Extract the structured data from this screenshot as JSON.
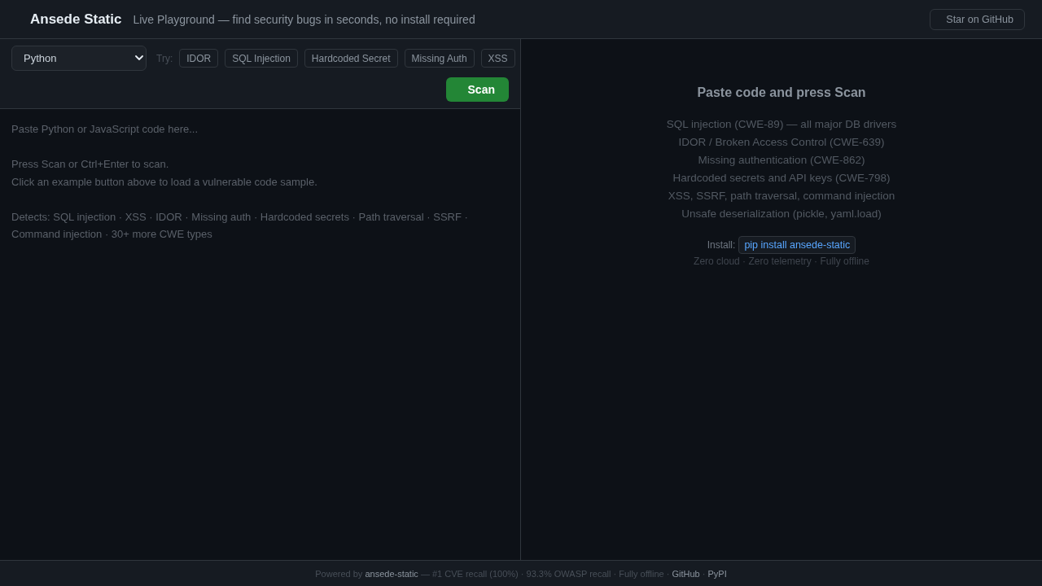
{
  "header": {
    "title": "Ansede Static",
    "subtitle": "Live Playground — find security bugs in seconds, no install required",
    "star_button": "Star on GitHub"
  },
  "toolbar": {
    "language": "Python",
    "try_label": "Try:",
    "examples": [
      "IDOR",
      "SQL Injection",
      "Hardcoded Secret",
      "Missing Auth",
      "XSS"
    ],
    "scan_button": "Scan"
  },
  "editor": {
    "placeholder": "Paste Python or JavaScript code here...\n\nPress Scan or Ctrl+Enter to scan.\nClick an example button above to load a vulnerable code sample.\n\nDetects: SQL injection · XSS · IDOR · Missing auth · Hardcoded secrets · Path traversal · SSRF · Command injection · 30+ more CWE types"
  },
  "results": {
    "heading": "Paste code and press Scan",
    "features": [
      "SQL injection (CWE-89) — all major DB drivers",
      "IDOR / Broken Access Control (CWE-639)",
      "Missing authentication (CWE-862)",
      "Hardcoded secrets and API keys (CWE-798)",
      "XSS, SSRF, path traversal, command injection",
      "Unsafe deserialization (pickle, yaml.load)"
    ],
    "install_label": "Install:",
    "install_command": "pip install ansede-static",
    "tagline": "Zero cloud · Zero telemetry · Fully offline"
  },
  "footer": {
    "segments": [
      {
        "kind": "text",
        "text": "Powered by "
      },
      {
        "kind": "link",
        "text": "ansede-static"
      },
      {
        "kind": "text",
        "text": " — #1 CVE recall (100%) · 93.3% OWASP recall · Fully offline · "
      },
      {
        "kind": "link",
        "text": "GitHub"
      },
      {
        "kind": "text",
        "text": " · "
      },
      {
        "kind": "link",
        "text": "PyPI"
      }
    ]
  }
}
